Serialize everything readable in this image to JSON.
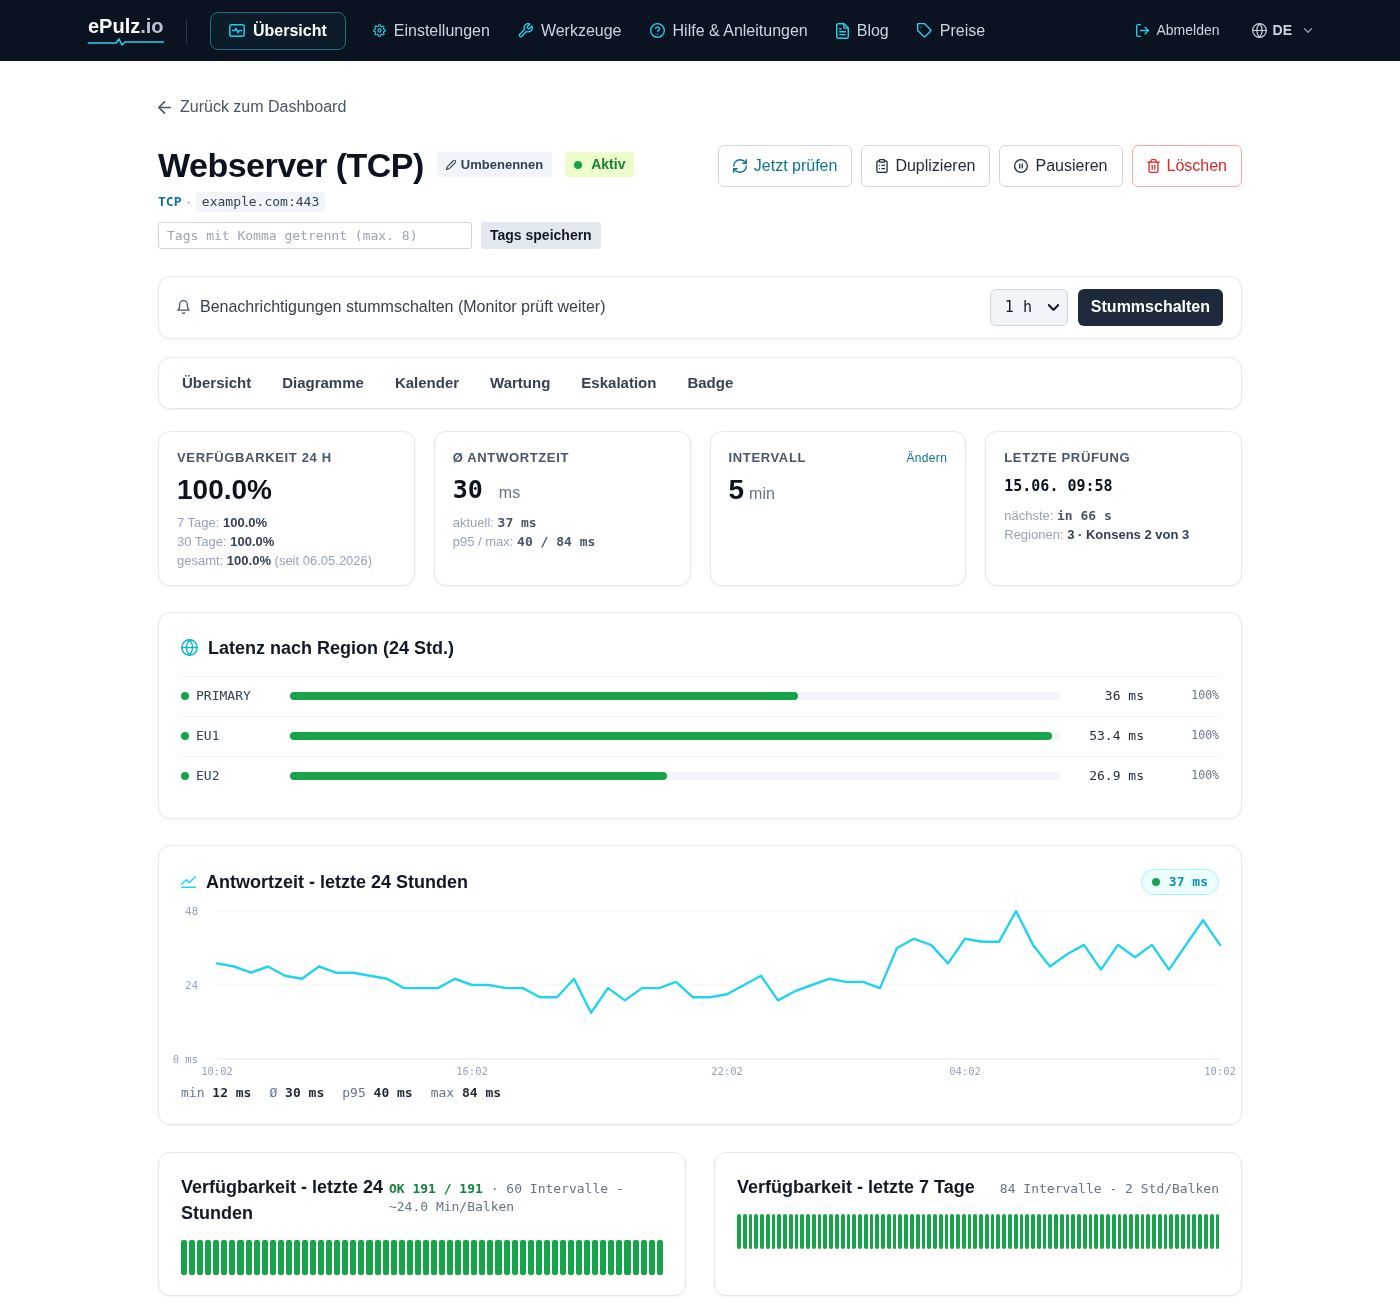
{
  "navbar": {
    "logo": {
      "name": "ePulz",
      "suffix": ".io"
    },
    "items": [
      {
        "label": "Übersicht",
        "selected": true
      },
      {
        "label": "Einstellungen",
        "selected": false
      },
      {
        "label": "Werkzeuge",
        "selected": false
      },
      {
        "label": "Hilfe & Anleitungen",
        "selected": false
      },
      {
        "label": "Blog",
        "selected": false
      },
      {
        "label": "Preise",
        "selected": false
      }
    ],
    "logout": "Abmelden",
    "language": "DE"
  },
  "back_link": "Zurück zum Dashboard",
  "monitor": {
    "title": "Webserver (TCP)",
    "rename": "Umbenennen",
    "status": {
      "label": "Aktiv",
      "active": true
    },
    "protocol": "TCP",
    "separator": "·",
    "target": "example.com:443"
  },
  "actions": [
    {
      "label": "Jetzt prüfen",
      "kind": "primary"
    },
    {
      "label": "Duplizieren",
      "kind": "default"
    },
    {
      "label": "Pausieren",
      "kind": "default"
    },
    {
      "label": "Löschen",
      "kind": "danger"
    }
  ],
  "tags": {
    "placeholder": "Tags mit Komma getrennt (max. 8)",
    "button": "Tags speichern"
  },
  "mute": {
    "text": "Benachrichtigungen stummschalten (Monitor prüft weiter)",
    "duration": "1 h",
    "button": "Stummschalten"
  },
  "tabs": [
    {
      "label": "Übersicht",
      "selected": false
    },
    {
      "label": "Diagramme",
      "selected": false
    },
    {
      "label": "Kalender",
      "selected": false
    },
    {
      "label": "Wartung",
      "selected": false
    },
    {
      "label": "Eskalation",
      "selected": false
    },
    {
      "label": "Badge",
      "selected": false
    }
  ],
  "stats": [
    {
      "kind": "big",
      "label": "VERFÜGBARKEIT 24 H",
      "value": "100.0%",
      "lines": [
        {
          "text": "7 Tage: **100.0%**",
          "kind": "text"
        },
        {
          "text": "30 Tage: **100.0%**",
          "kind": "text"
        },
        {
          "text": "gesamt: **100.0%** (seit 06.05.2026)",
          "kind": "text"
        }
      ]
    },
    {
      "kind": "code",
      "label": "Ø ANTWORTZEIT",
      "value": "30",
      "unit": "ms",
      "lines": [
        {
          "text": "aktuell: **37 ms**",
          "kind": "code"
        },
        {
          "text": "p95 / max: **40 / 84 ms**",
          "kind": "code"
        }
      ]
    },
    {
      "kind": "big",
      "label": "INTERVALL",
      "link": "Ändern",
      "value": "5",
      "unit": "min"
    },
    {
      "kind": "stamp",
      "label": "LETZTE PRÜFUNG",
      "value": "15.06. 09:58",
      "lines": [
        {
          "text": "nächste: **in 66 s**",
          "kind": "code"
        },
        {
          "text": "Regionen: **3 · Konsens 2 von 3**",
          "kind": "text"
        }
      ]
    }
  ],
  "latency": {
    "title": "Latenz nach Region (24 Std.)",
    "regions": [
      {
        "name": "PRIMARY",
        "level": 0.66,
        "value": "36 ms",
        "percent": "100%"
      },
      {
        "name": "EU1",
        "level": 0.99,
        "value": "53.4 ms",
        "percent": "100%"
      },
      {
        "name": "EU2",
        "level": 0.49,
        "value": "26.9 ms",
        "percent": "100%"
      }
    ]
  },
  "response_chart": {
    "title": "Antwortzeit - letzte 24 Stunden",
    "current": "37 ms",
    "chart_data": {
      "type": "line",
      "categories": [
        "10:02",
        null,
        null,
        null,
        null,
        null,
        null,
        null,
        null,
        null,
        null,
        null,
        null,
        null,
        null,
        "16:02",
        null,
        null,
        null,
        null,
        null,
        null,
        null,
        null,
        null,
        null,
        null,
        null,
        null,
        null,
        "22:02",
        null,
        null,
        null,
        null,
        null,
        null,
        null,
        null,
        null,
        null,
        null,
        null,
        null,
        "04:02",
        null,
        null,
        null,
        null,
        null,
        null,
        null,
        null,
        null,
        null,
        null,
        null,
        null,
        null,
        "10:02"
      ],
      "values": [
        31,
        30,
        28,
        30,
        27,
        26,
        30,
        28,
        28,
        27,
        26,
        23,
        23,
        23,
        26,
        24,
        24,
        23,
        23,
        20,
        20,
        26,
        15,
        23,
        19,
        23,
        23,
        25,
        20,
        20,
        21,
        24,
        27,
        19,
        22,
        24,
        26,
        25,
        25,
        23,
        36,
        39,
        37,
        31,
        39,
        38,
        38,
        48,
        37,
        30,
        34,
        37,
        29,
        37,
        33,
        37,
        29,
        37,
        45,
        37
      ],
      "ylim": [
        0,
        48
      ],
      "yticks": [
        {
          "value": 0,
          "label": "0 ms"
        },
        24,
        48
      ]
    },
    "summary": [
      "min **12 ms**",
      "Ø **30 ms**",
      "p95 **40 ms**",
      "max **84 ms**"
    ]
  },
  "availability": [
    {
      "title": "Verfügbarkeit - letzte 24 Stunden",
      "meta": "**OK 191 / 191** · 60 Intervalle - ~24.0 Min/Balken",
      "bars": [
        {
          "ok": true
        },
        {
          "ok": true
        },
        {
          "ok": true
        },
        {
          "ok": true
        },
        {
          "ok": true
        },
        {
          "ok": true
        },
        {
          "ok": true
        },
        {
          "ok": true
        },
        {
          "ok": true
        },
        {
          "ok": true
        },
        {
          "ok": true
        },
        {
          "ok": true
        },
        {
          "ok": true
        },
        {
          "ok": true
        },
        {
          "ok": true
        },
        {
          "ok": true
        },
        {
          "ok": true
        },
        {
          "ok": true
        },
        {
          "ok": true
        },
        {
          "ok": true
        },
        {
          "ok": true
        },
        {
          "ok": true
        },
        {
          "ok": true
        },
        {
          "ok": true
        },
        {
          "ok": true
        },
        {
          "ok": true
        },
        {
          "ok": true
        },
        {
          "ok": true
        },
        {
          "ok": true
        },
        {
          "ok": true
        },
        {
          "ok": true
        },
        {
          "ok": true
        },
        {
          "ok": true
        },
        {
          "ok": true
        },
        {
          "ok": true
        },
        {
          "ok": true
        },
        {
          "ok": true
        },
        {
          "ok": true
        },
        {
          "ok": true
        },
        {
          "ok": true
        },
        {
          "ok": true
        },
        {
          "ok": true
        },
        {
          "ok": true
        },
        {
          "ok": true
        },
        {
          "ok": true
        },
        {
          "ok": true
        },
        {
          "ok": true
        },
        {
          "ok": true
        },
        {
          "ok": true
        },
        {
          "ok": true
        },
        {
          "ok": true
        },
        {
          "ok": true
        },
        {
          "ok": true
        },
        {
          "ok": true
        },
        {
          "ok": true
        },
        {
          "ok": true
        },
        {
          "ok": true
        },
        {
          "ok": true
        },
        {
          "ok": true
        },
        {
          "ok": true
        }
      ]
    },
    {
      "title": "Verfügbarkeit - letzte 7 Tage",
      "meta": "84 Intervalle - 2 Std/Balken",
      "bars": [
        {
          "ok": true
        },
        {
          "ok": true
        },
        {
          "ok": true
        },
        {
          "ok": true
        },
        {
          "ok": true
        },
        {
          "ok": true
        },
        {
          "ok": true
        },
        {
          "ok": true
        },
        {
          "ok": true
        },
        {
          "ok": true
        },
        {
          "ok": true
        },
        {
          "ok": true
        },
        {
          "ok": true
        },
        {
          "ok": true
        },
        {
          "ok": true
        },
        {
          "ok": true
        },
        {
          "ok": true
        },
        {
          "ok": true
        },
        {
          "ok": true
        },
        {
          "ok": true
        },
        {
          "ok": true
        },
        {
          "ok": true
        },
        {
          "ok": true
        },
        {
          "ok": true
        },
        {
          "ok": true
        },
        {
          "ok": true
        },
        {
          "ok": true
        },
        {
          "ok": true
        },
        {
          "ok": true
        },
        {
          "ok": true
        },
        {
          "ok": true
        },
        {
          "ok": true
        },
        {
          "ok": true
        },
        {
          "ok": true
        },
        {
          "ok": true
        },
        {
          "ok": true
        },
        {
          "ok": true
        },
        {
          "ok": true
        },
        {
          "ok": true
        },
        {
          "ok": true
        },
        {
          "ok": true
        },
        {
          "ok": true
        },
        {
          "ok": true
        },
        {
          "ok": true
        },
        {
          "ok": true
        },
        {
          "ok": true
        },
        {
          "ok": true
        },
        {
          "ok": true
        },
        {
          "ok": true
        },
        {
          "ok": true
        },
        {
          "ok": true
        },
        {
          "ok": true
        },
        {
          "ok": true
        },
        {
          "ok": true
        },
        {
          "ok": true
        },
        {
          "ok": true
        },
        {
          "ok": true
        },
        {
          "ok": true
        },
        {
          "ok": true
        },
        {
          "ok": true
        },
        {
          "ok": true
        },
        {
          "ok": true
        },
        {
          "ok": true
        },
        {
          "ok": true
        },
        {
          "ok": true
        },
        {
          "ok": true
        },
        {
          "ok": true
        },
        {
          "ok": true
        },
        {
          "ok": true
        },
        {
          "ok": true
        },
        {
          "ok": true
        },
        {
          "ok": true
        },
        {
          "ok": true
        },
        {
          "ok": true
        },
        {
          "ok": true
        },
        {
          "ok": true
        },
        {
          "ok": true
        },
        {
          "ok": true
        },
        {
          "ok": true
        },
        {
          "ok": true
        },
        {
          "ok": true
        },
        {
          "ok": true
        },
        {
          "ok": true
        },
        {
          "ok": true
        }
      ]
    }
  ]
}
